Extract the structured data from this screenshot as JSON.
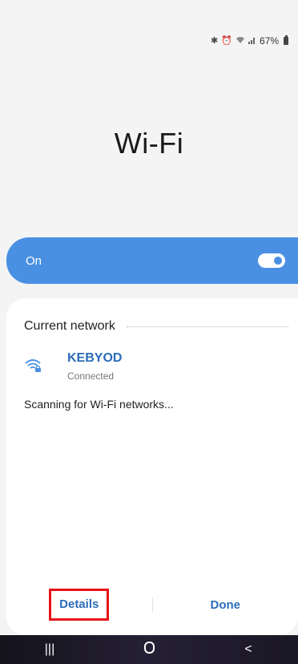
{
  "status_bar": {
    "bluetooth_icon": "bluetooth-icon",
    "alarm_icon": "alarm-icon",
    "wifi_icon": "wifi-icon",
    "signal_icon": "signal-icon",
    "battery_text": "67%",
    "battery_icon": "battery-icon"
  },
  "header": {
    "title": "Wi-Fi"
  },
  "toggle_bar": {
    "label": "On",
    "state": true
  },
  "current_network": {
    "header": "Current network",
    "name": "KEBYOD",
    "status": "Connected",
    "icon": "wifi-lock-icon"
  },
  "scanning_text": "Scanning for Wi-Fi networks...",
  "actions": {
    "details_label": "Details",
    "done_label": "Done"
  },
  "nav": {
    "recents": "recents-icon",
    "home": "home-icon",
    "back": "back-icon"
  },
  "colors": {
    "accent": "#4a90e2",
    "link": "#2a6cb8",
    "highlight": "#e8101a"
  }
}
